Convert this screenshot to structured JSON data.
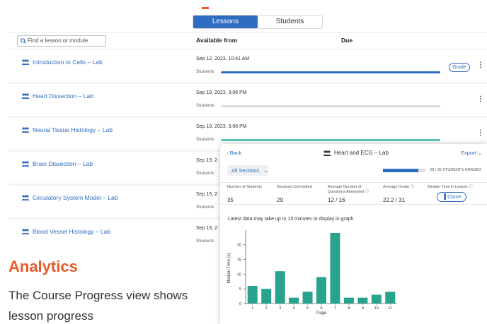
{
  "tabs": [
    {
      "label": "Lessons",
      "active": true
    },
    {
      "label": "Students",
      "active": false
    }
  ],
  "search": {
    "placeholder": "Find a lesson or module"
  },
  "columns": {
    "available_from": "Available from",
    "due": "Due"
  },
  "lessons": [
    {
      "name": "Introduction to Cells – Lab",
      "date": "Sep 12, 2023, 10:41 AM",
      "students_label": "Students",
      "progress": 1.0,
      "color": "#2d6cc0",
      "grade_label": "Grade"
    },
    {
      "name": "Heart Dissection – Lab",
      "date": "Sep 19, 2023, 3:06 PM",
      "students_label": "Students",
      "progress": 0.0,
      "color": "#2d6cc0"
    },
    {
      "name": "Neural Tissue Histology – Lab",
      "date": "Sep 19, 2023, 3:06 PM",
      "students_label": "Students",
      "progress": 1.0,
      "color": "#5cc6b8"
    },
    {
      "name": "Brain Dissection – Lab",
      "date": "Sep 19, 2",
      "students_label": "Students"
    },
    {
      "name": "Circulatory System Model – Lab",
      "date": "Sep 19, 2",
      "students_label": "Students"
    },
    {
      "name": "Blood Vessel Histology – Lab",
      "date": "Sep 19, 2",
      "students_label": "Students"
    }
  ],
  "heading": "Analytics",
  "description": "The Course Progress view shows lesson progress",
  "card": {
    "back_label": "‹ Back",
    "title": "Heart and ECG – Lab",
    "export_label": "Export ⌄",
    "section_label": "All Sections",
    "graded_text": "29 / 35 STUDENTS GRADED",
    "graded_fraction": 0.83,
    "stats": [
      {
        "label": "Number of Students",
        "value": "35"
      },
      {
        "label": "Students Committed",
        "value": "29"
      },
      {
        "label": "Average Number of Questions Attempted",
        "value": "12 / 16"
      },
      {
        "label": "Average Grade",
        "value": "22.2 / 31"
      },
      {
        "label": "Median Time in Lesson",
        "value": ""
      }
    ],
    "close_label": "Close",
    "note": "Latest data may take up to 15 minutes to display in graph."
  },
  "chart_data": {
    "type": "bar",
    "categories": [
      "1",
      "2",
      "3",
      "4",
      "5",
      "6",
      "7",
      "8",
      "9",
      "10",
      "11"
    ],
    "values": [
      6,
      5,
      11,
      2,
      4,
      9,
      24,
      2,
      2,
      3,
      4
    ],
    "xlabel": "Page",
    "ylabel": "Median Time (s)",
    "yticks": [
      0,
      5,
      10,
      15,
      20
    ],
    "ylim": [
      0,
      24
    ],
    "color": "#2aa38e",
    "grid": false
  }
}
